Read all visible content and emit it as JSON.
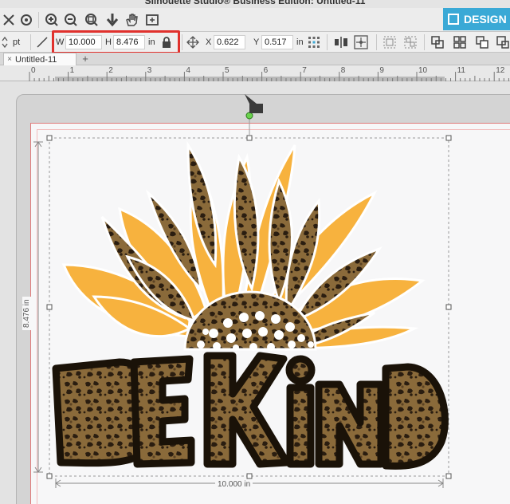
{
  "window": {
    "title": "Silhouette Studio® Business Edition: Untitled-11"
  },
  "toolbar": {
    "design_tab_label": "DESIGN",
    "icons": [
      "select-icon",
      "point-edit-icon",
      "zoom-in-icon",
      "zoom-out-icon",
      "zoom-fit-icon",
      "move-down-icon",
      "hand-pan-icon",
      "page-fit-icon"
    ]
  },
  "size_bar": {
    "line_unit": "pt",
    "width_label": "W",
    "width_value": "10.000",
    "height_label": "H",
    "height_value": "8.476",
    "size_unit": "in",
    "x_label": "X",
    "x_value": "0.622",
    "y_label": "Y",
    "y_value": "0.517",
    "pos_unit": "in"
  },
  "tabs": {
    "close_glyph": "×",
    "document_name": "Untitled-11",
    "add_glyph": "+"
  },
  "ruler": {
    "marks": [
      "0",
      "1",
      "2",
      "3",
      "4",
      "5",
      "6",
      "7",
      "8",
      "9",
      "10",
      "11",
      "12"
    ]
  },
  "canvas": {
    "width_dimension": "10.000 in",
    "height_dimension": "8.476 in",
    "design_text": "BE KIND",
    "colors": {
      "petal_yellow": "#f7b23e",
      "leopard_base": "#8a6a3a",
      "leopard_spot": "#2a1d10",
      "outline": "#1a1208"
    }
  }
}
